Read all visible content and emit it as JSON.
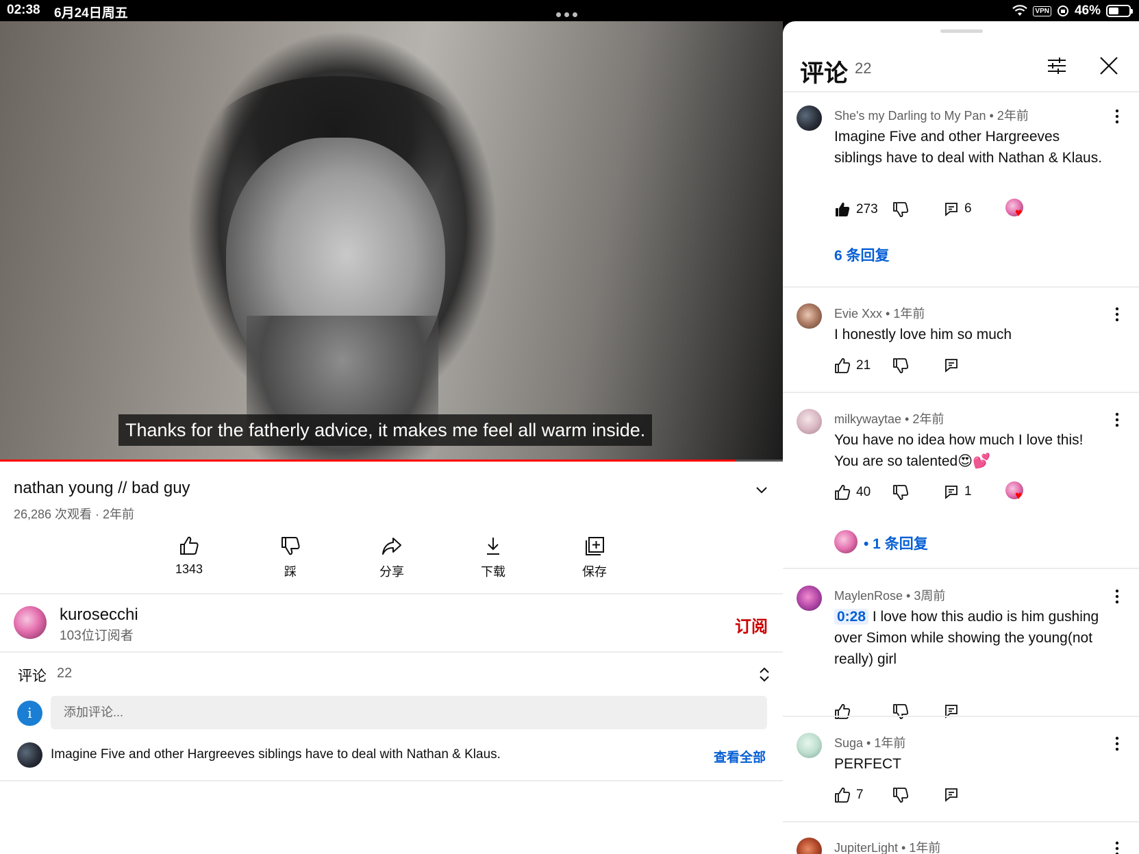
{
  "status_bar": {
    "time": "02:38",
    "date": "6月24日周五",
    "vpn": "VPN",
    "battery": "46%"
  },
  "video": {
    "subtitle": "Thanks for the fatherly advice, it makes me feel all warm inside.",
    "progress_fraction": 0.94,
    "title": "nathan young // bad guy",
    "meta": "26,286 次观看 · 2年前"
  },
  "actions": [
    {
      "label": "1343",
      "icon": "thumb-up-icon"
    },
    {
      "label": "踩",
      "icon": "thumb-down-icon"
    },
    {
      "label": "分享",
      "icon": "share-icon"
    },
    {
      "label": "下载",
      "icon": "download-icon"
    },
    {
      "label": "保存",
      "icon": "save-playlist-icon"
    }
  ],
  "channel": {
    "name": "kurosecchi",
    "subscribers": "103位订阅者",
    "subscribe_label": "订阅"
  },
  "comments_section": {
    "label": "评论",
    "count": "22",
    "avatar_letter": "i",
    "placeholder": "添加评论...",
    "top_comment": "Imagine Five and other Hargreeves siblings have to deal with Nathan & Klaus.",
    "see_all": "查看全部"
  },
  "panel": {
    "title": "评论",
    "count": "22",
    "comments": [
      {
        "header": "She's my Darling to My Pan • 2年前",
        "text": "Imagine Five and other Hargreeves siblings have to deal with Nathan & Klaus.",
        "likes": "273",
        "replies_count": "6",
        "replies_label": "6 条回复",
        "hearted": true
      },
      {
        "header": "Evie Xxx • 1年前",
        "text": "I honestly love him so much",
        "likes": "21",
        "replies_count": "",
        "hearted": false
      },
      {
        "header": "milkywaytae • 2年前",
        "text": "You have no idea how much I love this! You are so talented😍💕",
        "likes": "40",
        "replies_count": "1",
        "replies_label": "• 1 条回复",
        "hearted": true
      },
      {
        "header": "MaylenRose • 3周前",
        "timestamp": "0:28",
        "text": "I love how this audio is him gushing over Simon while showing the young(not really) girl",
        "likes": "",
        "replies_count": "",
        "hearted": false
      },
      {
        "header": "Suga • 1年前",
        "text": "PERFECT",
        "likes": "7",
        "replies_count": "",
        "hearted": false
      },
      {
        "header": "JupiterLight • 1年前"
      }
    ]
  },
  "colors": {
    "accent_blue": "#065fd4",
    "subscribe_red": "#cc0000",
    "progress_red": "#ff0000"
  }
}
